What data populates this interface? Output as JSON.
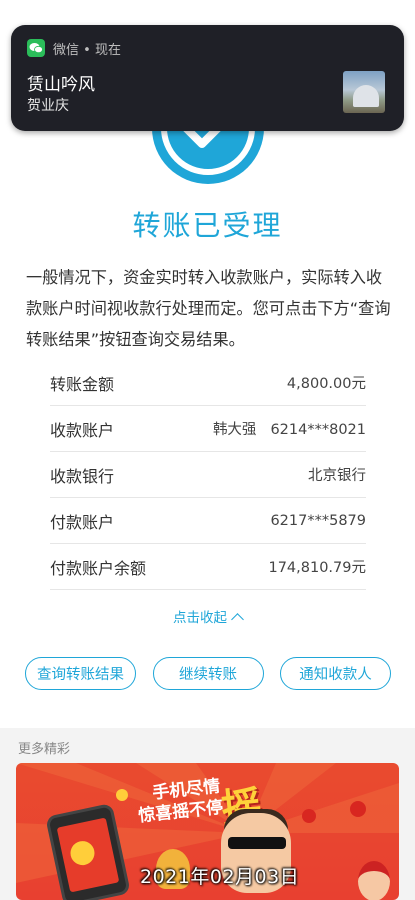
{
  "notification": {
    "app_name": "微信",
    "time": "现在",
    "separator": "•",
    "title": "赁山吟风",
    "body": "贺业庆",
    "app_icon": "wechat-icon",
    "thumbnail": "landscape-photo-thumbnail"
  },
  "status": {
    "icon": "check-circle-icon",
    "title": "转账已受理",
    "description": "一般情况下，资金实时转入收款账户，实际转入收款账户时间视收款行处理而定。您可点击下方“查询转账结果”按钮查询交易结果。"
  },
  "details": [
    {
      "label": "转账金额",
      "value": "4,800.00元"
    },
    {
      "label": "收款账户",
      "name": "韩大强",
      "value": "6214***8021"
    },
    {
      "label": "收款银行",
      "value": "北京银行"
    },
    {
      "label": "付款账户",
      "value": "6217***5879"
    },
    {
      "label": "付款账户余额",
      "value": "174,810.79元"
    }
  ],
  "collapse_label": "点击收起",
  "buttons": {
    "query": "查询转账结果",
    "continue": "继续转账",
    "notify": "通知收款人"
  },
  "more_section": {
    "title": "更多精彩",
    "banner_line1": "手机尽情",
    "banner_line2": "惊喜摇不停",
    "banner_big": "摇"
  },
  "date_stamp": "2021年02月03日",
  "colors": {
    "accent": "#1fa6d8",
    "notification_bg": "#1f2027",
    "banner_red": "#e84030"
  }
}
